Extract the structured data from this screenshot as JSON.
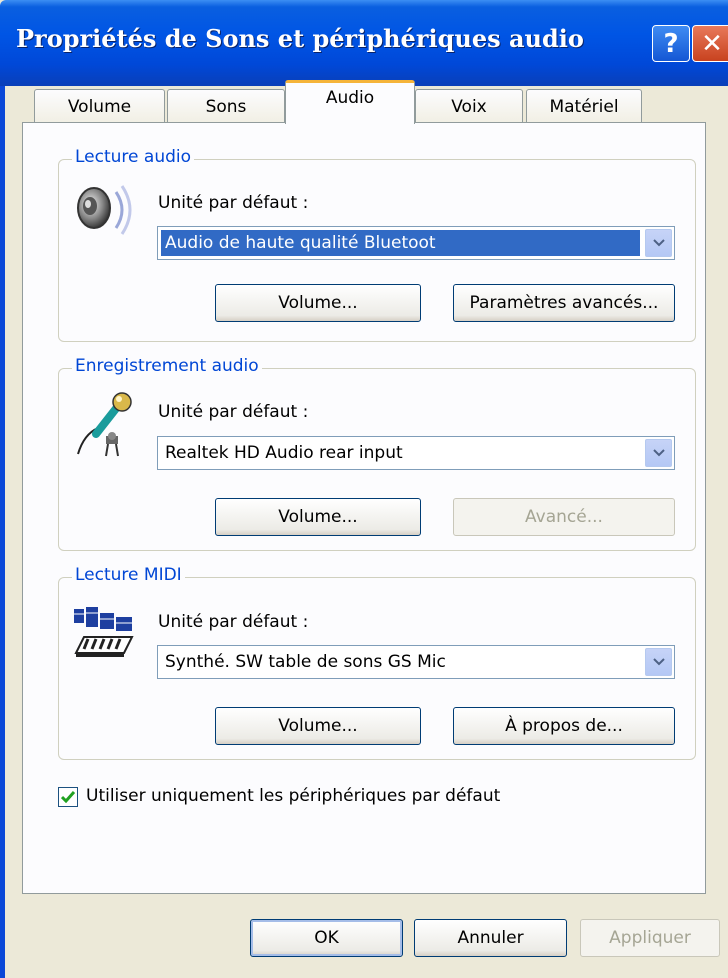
{
  "window": {
    "title": "Propriétés de Sons et périphériques audio",
    "help_glyph": "?",
    "close_glyph": "✕"
  },
  "tabs": [
    "Volume",
    "Sons",
    "Audio",
    "Voix",
    "Matériel"
  ],
  "active_tab": "Audio",
  "playback": {
    "group_title": "Lecture audio",
    "device_label": "Unité par défaut :",
    "device_value": "Audio de haute qualité Bluetoot",
    "volume_button": "Volume...",
    "advanced_button": "Paramètres avancés...",
    "icon": "speaker-icon"
  },
  "recording": {
    "group_title": "Enregistrement audio",
    "device_label": "Unité par défaut :",
    "device_value": "Realtek HD Audio rear input",
    "volume_button": "Volume...",
    "advanced_button": "Avancé...",
    "advanced_enabled": false,
    "icon": "microphone-icon"
  },
  "midi": {
    "group_title": "Lecture MIDI",
    "device_label": "Unité par défaut :",
    "device_value": "Synthé. SW table de sons GS Mic",
    "volume_button": "Volume...",
    "about_button": "À propos de...",
    "icon": "midi-keyboard-icon"
  },
  "default_only": {
    "label": "Utiliser uniquement les périphériques par défaut",
    "checked": true
  },
  "footer": {
    "ok": "OK",
    "cancel": "Annuler",
    "apply": "Appliquer",
    "apply_enabled": false
  },
  "colors": {
    "title_bar": "#0055e5",
    "group_title": "#0046d5",
    "selection": "#316ac5",
    "dialog_bg": "#ece9d8",
    "panel_bg": "#fcfcfe",
    "close_button": "#c8421f"
  }
}
